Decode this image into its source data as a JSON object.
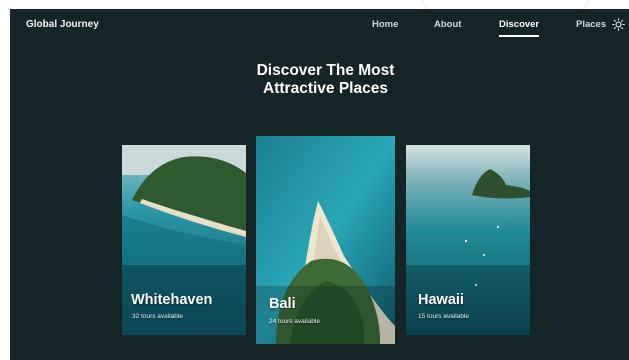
{
  "brand": "Global Journey",
  "nav": {
    "items": [
      "Home",
      "About",
      "Discover",
      "Places"
    ],
    "active": "Discover"
  },
  "theme_toggle_icon": "sun-icon",
  "headline": {
    "line1": "Discover The Most",
    "line2": "Attractive Places"
  },
  "destinations": [
    {
      "name": "Whitehaven",
      "tours": "32 tours available"
    },
    {
      "name": "Bali",
      "tours": "24 tours available"
    },
    {
      "name": "Hawaii",
      "tours": "15 tours available"
    }
  ],
  "colors": {
    "background": "#152427",
    "text": "#ffffff",
    "ocean": "#1a8fa0"
  }
}
